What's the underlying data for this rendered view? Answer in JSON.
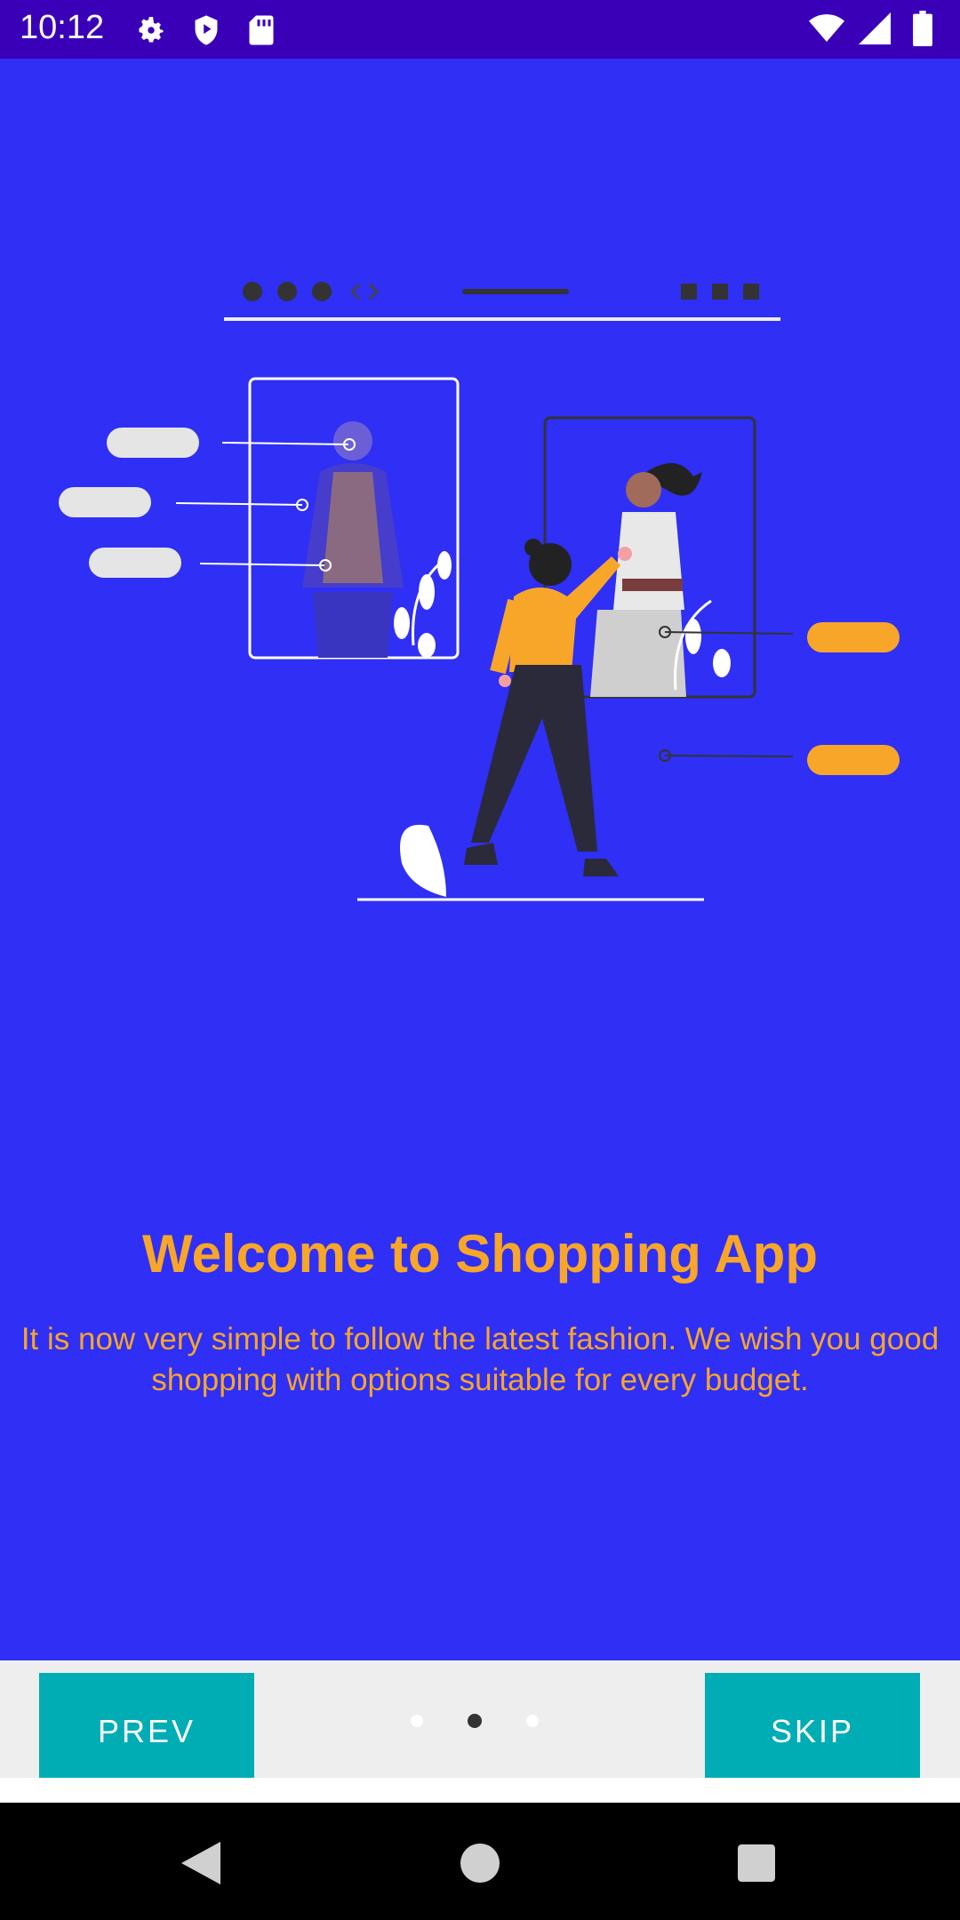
{
  "status_bar": {
    "time": "10:12",
    "left_icons": [
      "gear-icon",
      "shield-icon",
      "sd-card-icon"
    ],
    "right_icons": [
      "wifi-icon",
      "cell-signal-icon",
      "battery-icon"
    ],
    "background": "#3a00b8"
  },
  "onboarding": {
    "title": "Welcome to Shopping App",
    "description": "It is now very simple to follow the latest fashion. We wish you good shopping with options suitable for every budget.",
    "background": "#2f2ff5",
    "accent": "#f8a62a"
  },
  "controls": {
    "prev_label": "PREV",
    "skip_label": "SKIP",
    "page_count": 3,
    "current_page": 2,
    "button_color": "#00adb5"
  },
  "system_nav": {
    "icons": [
      "back-icon",
      "home-icon",
      "recents-icon"
    ]
  }
}
